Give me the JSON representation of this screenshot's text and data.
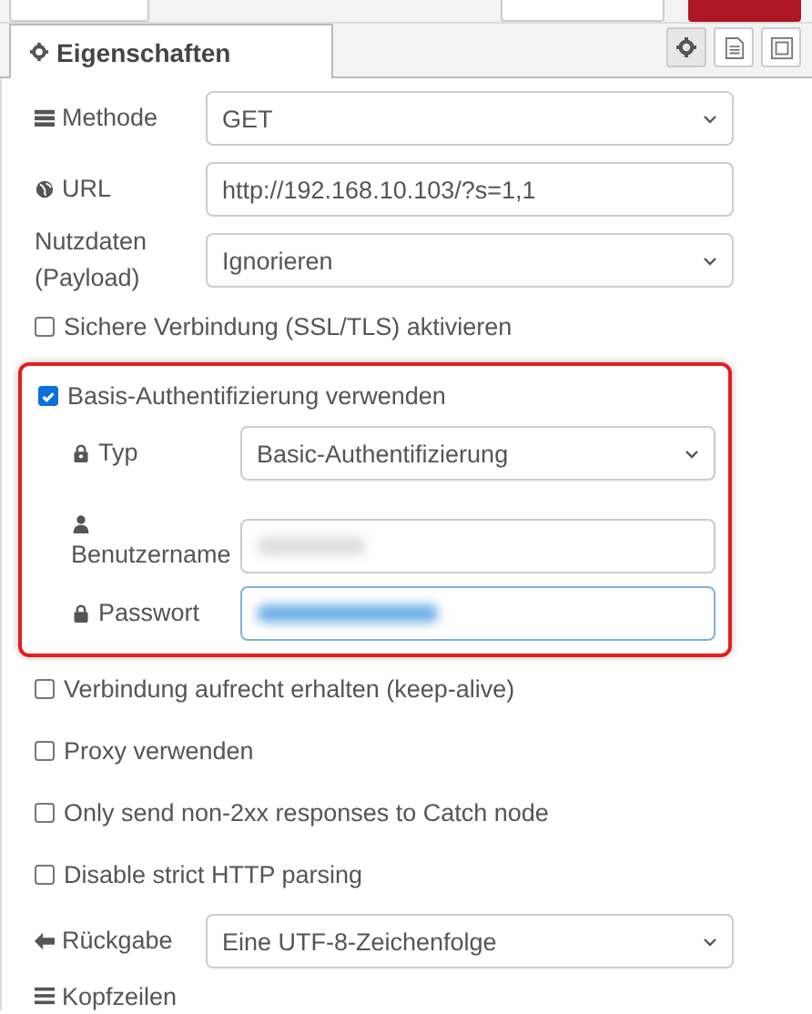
{
  "tabs": [
    {
      "label": "Eigenschaften",
      "selected": true
    }
  ],
  "tool_buttons": [
    {
      "kind": "gear",
      "selected": true
    },
    {
      "kind": "doc",
      "selected": false
    },
    {
      "kind": "frame",
      "selected": false
    }
  ],
  "rows": [
    {
      "kind": "select",
      "label": "Methode",
      "value": "GET"
    },
    {
      "kind": "text",
      "label": "URL",
      "value": "http://192.168.10.103/?s=1,1"
    },
    {
      "kind": "select",
      "label": "Nutzdaten (Payload)",
      "value": "Ignorieren"
    },
    {
      "kind": "checkbox",
      "label": "Sichere Verbindung (SSL/TLS) aktivieren",
      "checked": false
    },
    {
      "kind": "group",
      "highlighted": true,
      "label": "Basis-Authentifizierung verwenden",
      "checked": true,
      "fields": [
        {
          "kind": "select",
          "label": "Typ",
          "value": "Basic-Authentifizierung"
        },
        {
          "kind": "obscured",
          "label": "Benutzername",
          "focused": false
        },
        {
          "kind": "obscured",
          "label": "Passwort",
          "focused": true
        }
      ]
    },
    {
      "kind": "checkbox",
      "label": "Verbindung aufrecht erhalten (keep-alive)",
      "checked": false
    },
    {
      "kind": "checkbox",
      "label": "Proxy verwenden",
      "checked": false
    },
    {
      "kind": "checkbox",
      "label": "Only send non-2xx responses to Catch node",
      "checked": false
    },
    {
      "kind": "checkbox",
      "label": "Disable strict HTTP parsing",
      "checked": false
    },
    {
      "kind": "select",
      "label": "Rückgabe",
      "value": "Eine UTF-8-Zeichenfolge"
    },
    {
      "kind": "heading",
      "label": "Kopfzeilen"
    }
  ]
}
